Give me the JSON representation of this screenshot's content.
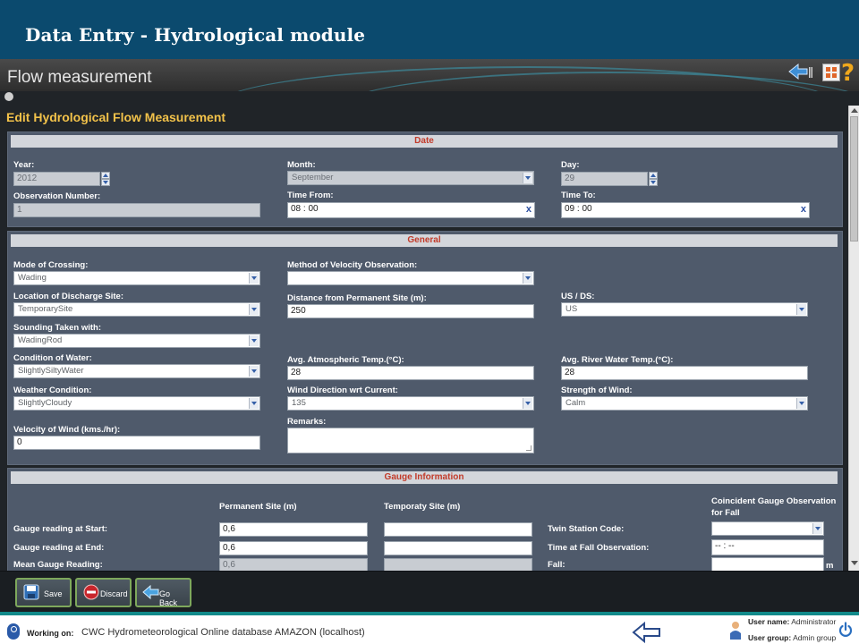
{
  "slide": {
    "title": "Data Entry - Hydrological module"
  },
  "app": {
    "title": "Flow measurement",
    "help_symbol": "?"
  },
  "form": {
    "title": "Edit Hydrological Flow Measurement",
    "date_section": {
      "heading": "Date",
      "year_label": "Year:",
      "year_value": "2012",
      "month_label": "Month:",
      "month_value": "September",
      "day_label": "Day:",
      "day_value": "29",
      "obs_label": "Observation Number:",
      "obs_value": "1",
      "time_from_label": "Time From:",
      "time_from_value": "08 : 00",
      "time_to_label": "Time To:",
      "time_to_value": "09 : 00",
      "clear_symbol": "x"
    },
    "general_section": {
      "heading": "General",
      "mode_label": "Mode of Crossing:",
      "mode_value": "Wading",
      "method_label": "Method of Velocity Observation:",
      "method_value": "",
      "location_label": "Location of Discharge Site:",
      "location_value": "TemporarySite",
      "distance_label": "Distance from Permanent Site (m):",
      "distance_value": "250",
      "usds_label": "US / DS:",
      "usds_value": "US",
      "sounding_label": "Sounding Taken with:",
      "sounding_value": "WadingRod",
      "condition_label": "Condition of Water:",
      "condition_value": "SlightlySiltyWater",
      "atm_label": "Avg. Atmospheric Temp.(°C):",
      "atm_value": "28",
      "river_label": "Avg. River Water Temp.(°C):",
      "river_value": "28",
      "weather_label": "Weather Condition:",
      "weather_value": "SlightlyCloudy",
      "winddir_label": "Wind Direction wrt Current:",
      "winddir_value": "135",
      "strength_label": "Strength of Wind:",
      "strength_value": "Calm",
      "remarks_label": "Remarks:",
      "velocity_label": "Velocity of Wind (kms./hr):",
      "velocity_value": "0"
    },
    "gauge_section": {
      "heading": "Gauge Information",
      "col_permanent": "Permanent Site (m)",
      "col_temporary": "Temporaty Site (m)",
      "col_coincident": "Coincident Gauge Observation for Fall",
      "start_label": "Gauge reading at Start:",
      "start_value": "0,6",
      "end_label": "Gauge reading at End:",
      "end_value": "0,6",
      "mean_label": "Mean Gauge Reading:",
      "mean_value": "0,6",
      "twin_label": "Twin Station Code:",
      "time_fall_label": "Time at Fall Observation:",
      "time_fall_value": "-- : --",
      "fall_label": "Fall:",
      "fall_unit": "m"
    }
  },
  "actions": {
    "save": "Save",
    "discard": "Discard",
    "back": "Go Back"
  },
  "status": {
    "working_on_label": "Working on:",
    "database": "CWC Hydrometeorological Online database AMAZON (localhost)",
    "user_name_label": "User name:",
    "user_name": "Administrator",
    "user_group_label": "User group:",
    "user_group": "Admin group"
  },
  "colors": {
    "banner": "#0b4a6e",
    "form_title": "#f2c24a",
    "section_heading": "#c23b2a",
    "accent_border": "#7ea85c",
    "status_accent": "#118a8a"
  }
}
